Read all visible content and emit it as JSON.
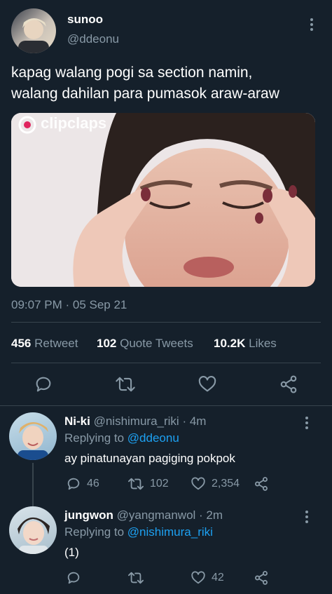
{
  "tweet": {
    "author_name": "sunoo",
    "author_handle": "@ddeonu",
    "text_line1": "kapag walang pogi sa section namin,",
    "text_line2": "walang dahilan para pumasok araw-araw",
    "media_watermark": "clipclaps",
    "timestamp": "09:07 PM · 05 Sep 21",
    "stats": {
      "retweets_count": "456",
      "retweets_label": "Retweet",
      "quotes_count": "102",
      "quotes_label": "Quote Tweets",
      "likes_count": "10.2K",
      "likes_label": "Likes"
    }
  },
  "replies": [
    {
      "name": "Ni-ki",
      "handle": "@nishimura_riki",
      "time": "· 4m",
      "replying_label": "Replying to",
      "replying_to": "@ddeonu",
      "text": "ay pinatunayan pagiging pokpok",
      "reply_count": "46",
      "retweet_count": "102",
      "like_count": "2,354"
    },
    {
      "name": "jungwon",
      "handle": "@yangmanwol",
      "time": "· 2m",
      "replying_label": "Replying to",
      "replying_to": "@nishimura_riki",
      "text": "(1)",
      "reply_count": "",
      "retweet_count": "",
      "like_count": "42"
    }
  ],
  "colors": {
    "background": "#15202b",
    "muted": "#8899a6",
    "link": "#1da1f2",
    "divider": "#38444d"
  },
  "icons": [
    "more-icon",
    "reply-icon",
    "retweet-icon",
    "like-icon",
    "share-icon",
    "clipclaps-logo-icon"
  ]
}
